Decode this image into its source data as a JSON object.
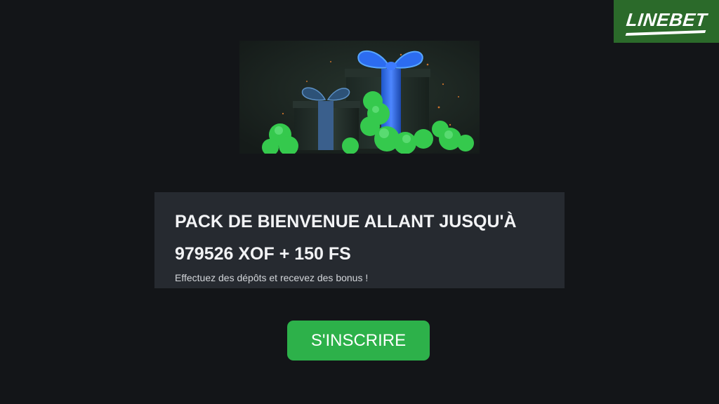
{
  "brand": {
    "logo_text": "LINEBET",
    "color": "#2b6a2a"
  },
  "hero": {
    "image_icon": "gift-boxes-icon",
    "accent_color": "#3cd35a"
  },
  "promo": {
    "title_line1": "PACK DE BIENVENUE ALLANT JUSQU'À",
    "title_line2": "979526 XOF + 150 FS",
    "subtitle": "Effectuez des dépôts et recevez des bonus !"
  },
  "cta": {
    "label": "S'INSCRIRE",
    "color": "#2db14a"
  }
}
